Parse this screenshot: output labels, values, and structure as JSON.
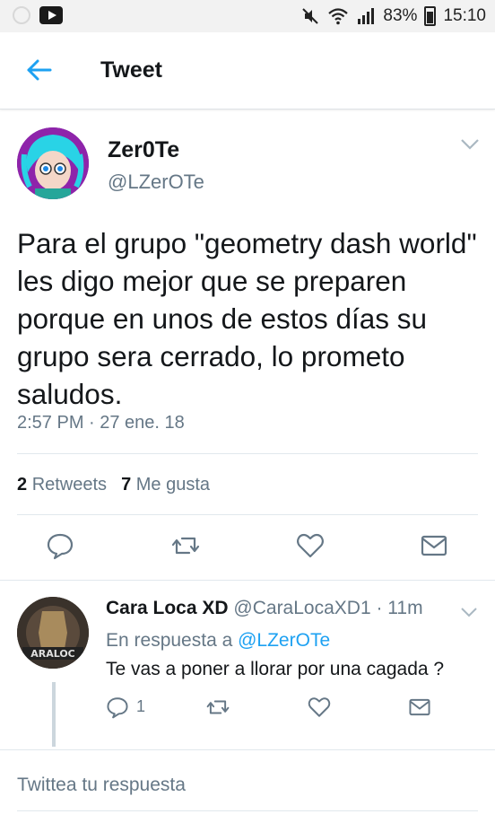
{
  "status_bar": {
    "battery": "83%",
    "time": "15:10",
    "icons": [
      "youtube-icon",
      "mute-icon",
      "wifi-icon",
      "signal-icon",
      "battery-icon"
    ]
  },
  "header": {
    "title": "Tweet",
    "back_icon": "arrow-left-icon",
    "accent_color": "#1da1f2"
  },
  "tweet": {
    "author_name": "Zer0Te",
    "author_handle": "@LZerOTe",
    "text": "Para el grupo \"geometry dash world\" les digo mejor que se preparen porque en unos de estos días su grupo sera cerrado, lo prometo saludos.",
    "timestamp": "2:57 PM · 27 ene. 18",
    "retweets_count": "2",
    "retweets_label": "Retweets",
    "likes_count": "7",
    "likes_label": "Me gusta",
    "actions": [
      "reply-icon",
      "retweet-icon",
      "like-icon",
      "dm-icon"
    ]
  },
  "reply": {
    "author_name": "Cara Loca XD",
    "author_handle": "@CaraLocaXD1",
    "time": "· 11m",
    "in_reply_to_label": "En respuesta a",
    "in_reply_to_handle": "@LZerOTe",
    "text": "Te vas a poner a llorar por una cagada ?",
    "reply_count": "1"
  },
  "compose": {
    "placeholder": "Twittea tu respuesta"
  }
}
